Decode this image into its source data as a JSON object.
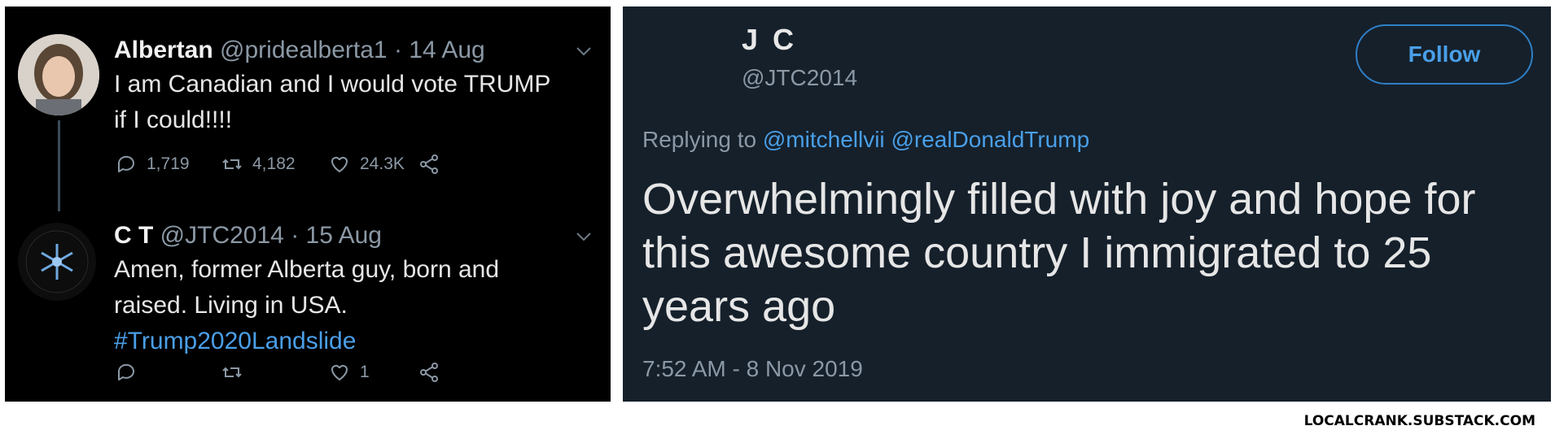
{
  "left_panel": {
    "tweet1": {
      "author_name": "Albertan",
      "author_meta": "@pridealberta1 · 14 Aug",
      "text_lines": [
        "I am Canadian and I would vote TRUMP",
        "if I could!!!!"
      ],
      "actions": {
        "replies": "1,719",
        "retweets": "4,182",
        "likes": "24.3K"
      }
    },
    "tweet2": {
      "author_name": "C T",
      "author_meta": "@JTC2014 · 15 Aug",
      "text_lines": [
        "Amen, former Alberta guy, born and",
        "raised. Living in USA."
      ],
      "hashtag": "#Trump2020Landslide",
      "actions": {
        "replies": "",
        "retweets": "",
        "likes": "1"
      }
    }
  },
  "right_panel": {
    "name": "J C",
    "handle": "@JTC2014",
    "follow_label": "Follow",
    "replying_prefix": "Replying to",
    "mentions": [
      "@mitchellvii",
      "@realDonaldTrump"
    ],
    "body_lines": [
      "Overwhelmingly filled with joy and hope for",
      "this awesome country I immigrated to 25",
      "years ago"
    ],
    "timestamp": "7:52 AM - 8 Nov 2019"
  },
  "watermark": "LOCALCRANK.SUBSTACK.COM",
  "colors": {
    "left_bg": "#000000",
    "right_bg": "#15202b",
    "accent_blue": "#4a9fe8",
    "muted_text": "#8b98a5"
  },
  "icons": [
    "reply-icon",
    "retweet-icon",
    "like-icon",
    "share-icon",
    "chevron-down-icon"
  ]
}
